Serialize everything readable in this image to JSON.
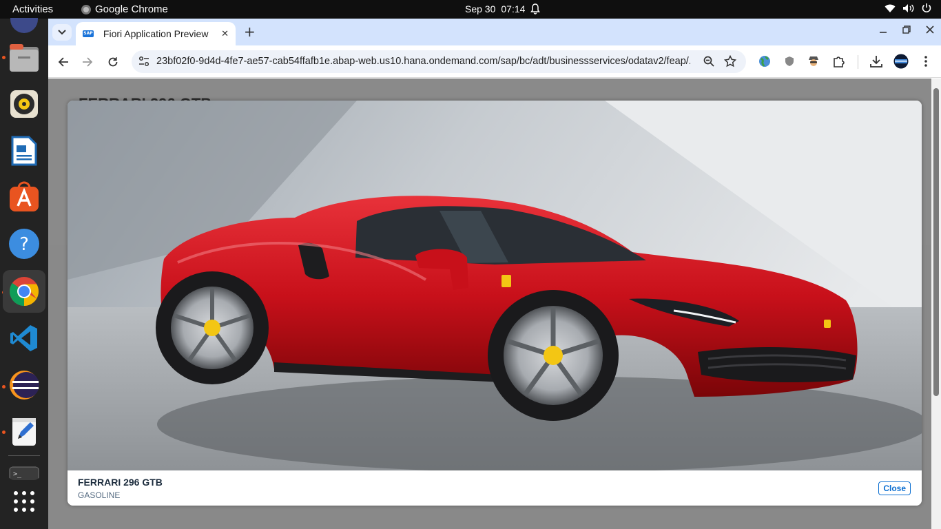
{
  "system": {
    "activities": "Activities",
    "app_name": "Google Chrome",
    "date": "Sep 30",
    "time": "07:14"
  },
  "browser": {
    "tab_title": "Fiori Application Preview",
    "url": "23bf02f0-9d4d-4fe7-ae57-cab54ffafb1e.abap-web.us10.hana.ondemand.com/sap/bc/adt/businessservices/odatav2/feap/..."
  },
  "page": {
    "background_title": "FERRARI 296 GTB"
  },
  "dialog": {
    "title": "FERRARI 296 GTB",
    "subtitle": "GASOLINE",
    "close_label": "Close",
    "image": "red sports car"
  },
  "colors": {
    "accent": "#0a6ed1",
    "car_red": "#c8101a",
    "dock_indicator": "#e95420"
  }
}
